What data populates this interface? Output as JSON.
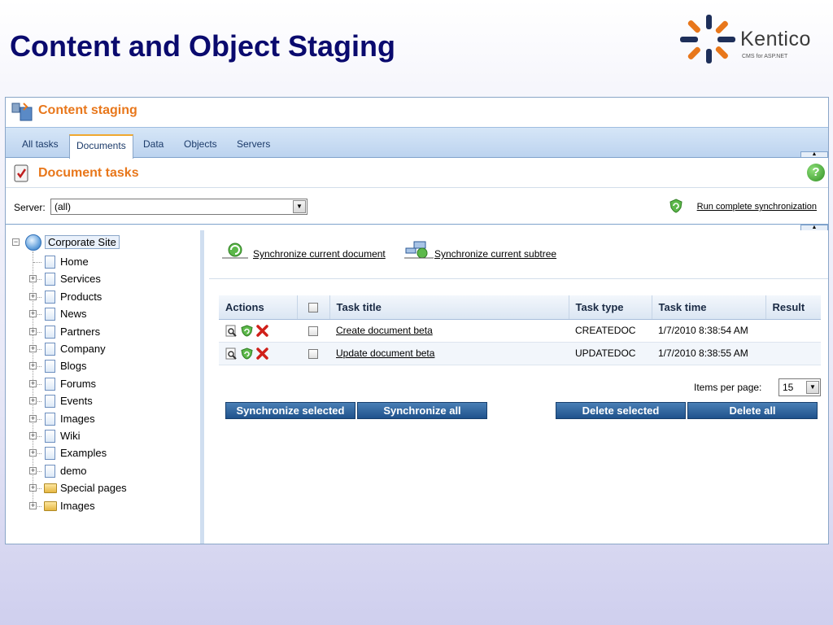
{
  "slide": {
    "title": "Content and Object Staging",
    "logo_text": "Kentico",
    "logo_subtitle": "CMS for ASP.NET",
    "logo_colors": [
      "#1e2f5a",
      "#e8771b"
    ]
  },
  "app": {
    "title": "Content staging",
    "accent_color": "#e8771b",
    "tabs": [
      {
        "label": "All tasks",
        "active": false
      },
      {
        "label": "Documents",
        "active": true
      },
      {
        "label": "Data",
        "active": false
      },
      {
        "label": "Objects",
        "active": false
      },
      {
        "label": "Servers",
        "active": false
      }
    ],
    "section_title": "Document tasks",
    "help_icon": "?",
    "server": {
      "label": "Server:",
      "value": "(all)"
    },
    "run_sync_label": "Run complete synchronization"
  },
  "tree": {
    "root": "Corporate Site",
    "items": [
      {
        "label": "Home",
        "type": "doc",
        "expandable": false
      },
      {
        "label": "Services",
        "type": "doc",
        "expandable": true
      },
      {
        "label": "Products",
        "type": "doc",
        "expandable": true
      },
      {
        "label": "News",
        "type": "doc",
        "expandable": true
      },
      {
        "label": "Partners",
        "type": "doc",
        "expandable": true
      },
      {
        "label": "Company",
        "type": "doc",
        "expandable": true
      },
      {
        "label": "Blogs",
        "type": "doc",
        "expandable": true
      },
      {
        "label": "Forums",
        "type": "doc",
        "expandable": true
      },
      {
        "label": "Events",
        "type": "doc",
        "expandable": true
      },
      {
        "label": "Images",
        "type": "doc",
        "expandable": true
      },
      {
        "label": "Wiki",
        "type": "doc",
        "expandable": true
      },
      {
        "label": "Examples",
        "type": "doc",
        "expandable": true
      },
      {
        "label": "demo",
        "type": "doc",
        "expandable": true
      },
      {
        "label": "Special pages",
        "type": "folder",
        "expandable": true
      },
      {
        "label": "Images",
        "type": "folder",
        "expandable": true
      }
    ]
  },
  "main": {
    "sync_current_document": "Synchronize current document",
    "sync_current_subtree": "Synchronize current subtree",
    "table": {
      "headers": {
        "actions": "Actions",
        "task_title": "Task title",
        "task_type": "Task type",
        "task_time": "Task time",
        "result": "Result"
      },
      "rows": [
        {
          "title": "Create document beta",
          "type": "CREATEDOC",
          "time": "1/7/2010 8:38:54 AM",
          "result": ""
        },
        {
          "title": "Update document beta",
          "type": "UPDATEDOC",
          "time": "1/7/2010 8:38:55 AM",
          "result": ""
        }
      ]
    },
    "items_per_page": {
      "label": "Items per page:",
      "value": "15"
    },
    "buttons": {
      "sync_selected": "Synchronize selected",
      "sync_all": "Synchronize all",
      "delete_selected": "Delete selected",
      "delete_all": "Delete all"
    }
  }
}
